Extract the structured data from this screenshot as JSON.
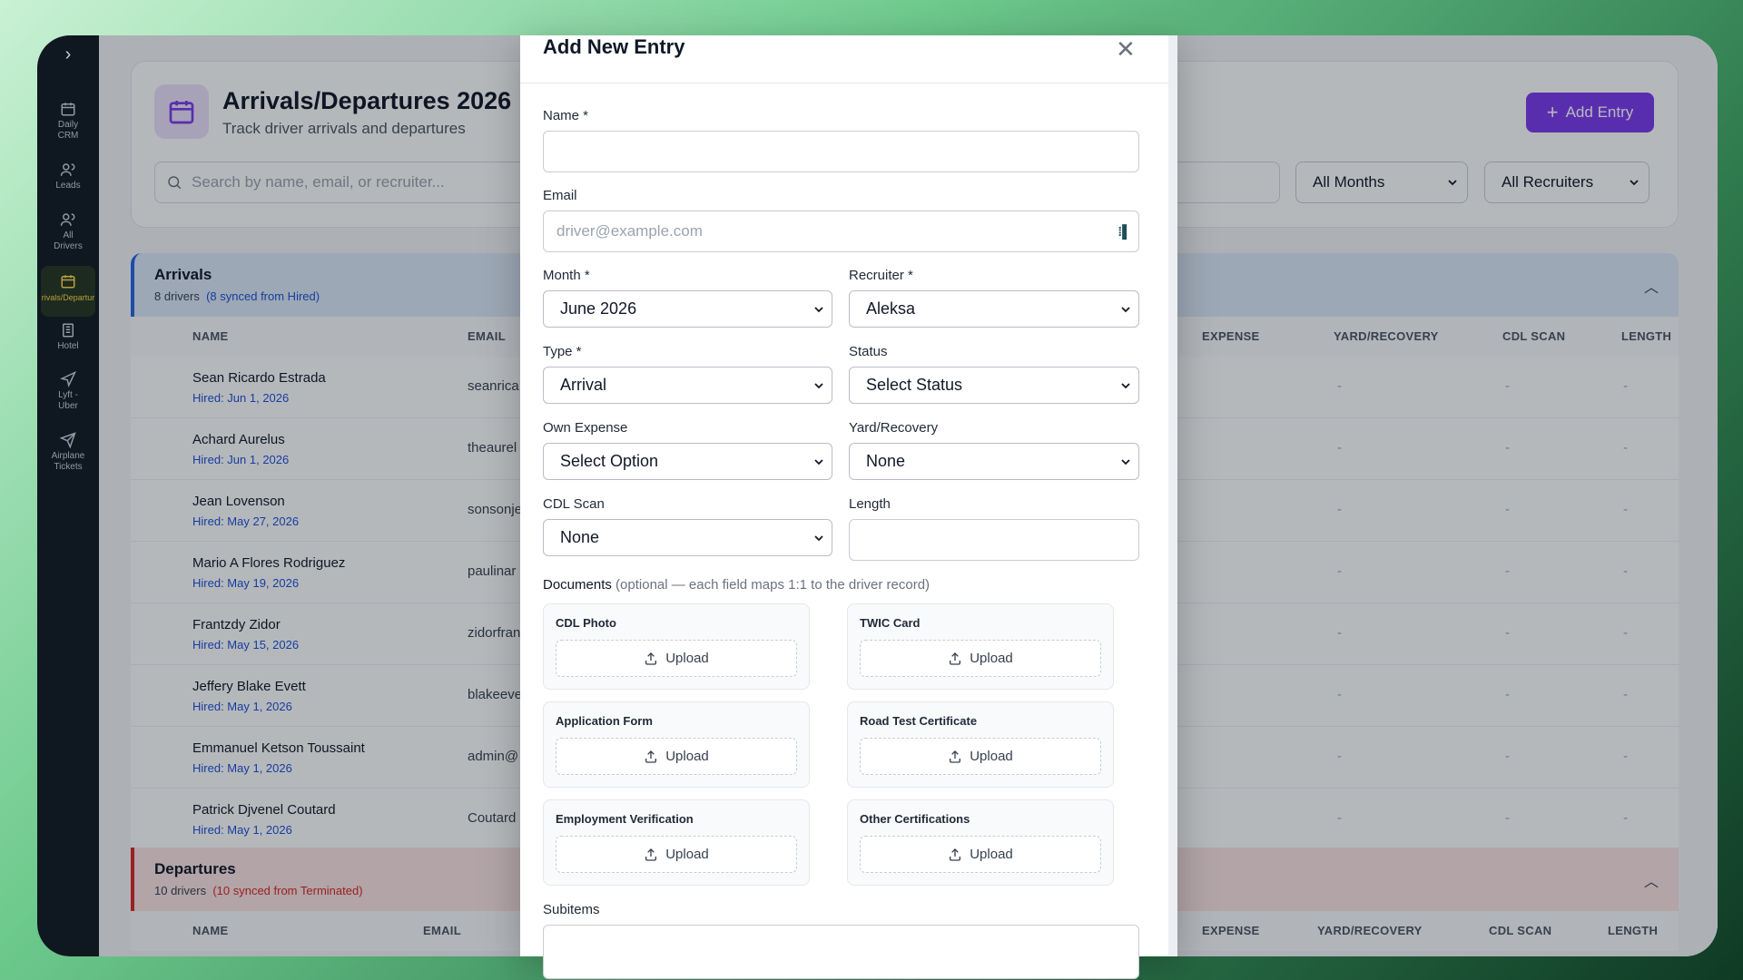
{
  "sidebar": {
    "toggle": "›",
    "items": [
      {
        "label": "Daily\nCRM",
        "icon": "calendar-icon"
      },
      {
        "label": "Leads",
        "icon": "users-icon"
      },
      {
        "label": "All\nDrivers",
        "icon": "users-icon"
      },
      {
        "label": "rivals/Departur",
        "icon": "calendar-icon",
        "active": true
      },
      {
        "label": "Hotel",
        "icon": "building-icon"
      },
      {
        "label": "Lyft -\nUber",
        "icon": "navigation-icon"
      },
      {
        "label": "Airplane\nTickets",
        "icon": "send-icon"
      }
    ]
  },
  "header": {
    "title": "Arrivals/Departures 2026",
    "subtitle": "Track driver arrivals and departures",
    "add_button": "Add Entry",
    "search_placeholder": "Search by name, email, or recruiter...",
    "month_filter": "All Months",
    "recruiter_filter": "All Recruiters"
  },
  "arrivals": {
    "title": "Arrivals",
    "count": "8 drivers",
    "synced": "(8 synced from Hired)",
    "columns": {
      "name": "NAME",
      "email": "EMAIL",
      "expense": "EXPENSE",
      "yard": "YARD/RECOVERY",
      "cdl": "CDL SCAN",
      "length": "LENGTH"
    },
    "rows": [
      {
        "name": "Sean Ricardo Estrada",
        "hired": "Hired: Jun 1, 2026",
        "email": "seanrica"
      },
      {
        "name": "Achard Aurelus",
        "hired": "Hired: Jun 1, 2026",
        "email": "theaurel"
      },
      {
        "name": "Jean Lovenson",
        "hired": "Hired: May 27, 2026",
        "email": "sonsonje"
      },
      {
        "name": "Mario A Flores Rodriguez",
        "hired": "Hired: May 19, 2026",
        "email": "paulinar"
      },
      {
        "name": "Frantzdy Zidor",
        "hired": "Hired: May 15, 2026",
        "email": "zidorfran"
      },
      {
        "name": "Jeffery Blake Evett",
        "hired": "Hired: May 1, 2026",
        "email": "blakeeve"
      },
      {
        "name": "Emmanuel Ketson Toussaint",
        "hired": "Hired: May 1, 2026",
        "email": "admin@"
      },
      {
        "name": "Patrick Djvenel Coutard",
        "hired": "Hired: May 1, 2026",
        "email": "Coutard"
      }
    ],
    "dash": "-"
  },
  "departures": {
    "title": "Departures",
    "count": "10 drivers",
    "synced": "(10 synced from Terminated)",
    "columns": {
      "name": "NAME",
      "email": "EMAIL",
      "expense": "EXPENSE",
      "yard": "YARD/RECOVERY",
      "cdl": "CDL SCAN",
      "length": "LENGTH"
    }
  },
  "modal": {
    "title": "Add New Entry",
    "close": "✕",
    "name_label": "Name *",
    "name_value": "",
    "email_label": "Email",
    "email_placeholder": "driver@example.com",
    "month_label": "Month *",
    "month_value": "June 2026",
    "recruiter_label": "Recruiter *",
    "recruiter_value": "Aleksa",
    "type_label": "Type *",
    "type_value": "Arrival",
    "status_label": "Status",
    "status_value": "Select Status",
    "own_expense_label": "Own Expense",
    "own_expense_value": "Select Option",
    "yard_label": "Yard/Recovery",
    "yard_value": "None",
    "cdl_scan_label": "CDL Scan",
    "cdl_scan_value": "None",
    "length_label": "Length",
    "length_value": "",
    "documents_label": "Documents",
    "documents_note": "(optional — each field maps 1:1 to the driver record)",
    "documents": [
      {
        "title": "CDL Photo",
        "button": "Upload"
      },
      {
        "title": "TWIC Card",
        "button": "Upload"
      },
      {
        "title": "Application Form",
        "button": "Upload"
      },
      {
        "title": "Road Test Certificate",
        "button": "Upload"
      },
      {
        "title": "Employment Verification",
        "button": "Upload"
      },
      {
        "title": "Other Certifications",
        "button": "Upload"
      }
    ],
    "subitems_label": "Subitems"
  }
}
